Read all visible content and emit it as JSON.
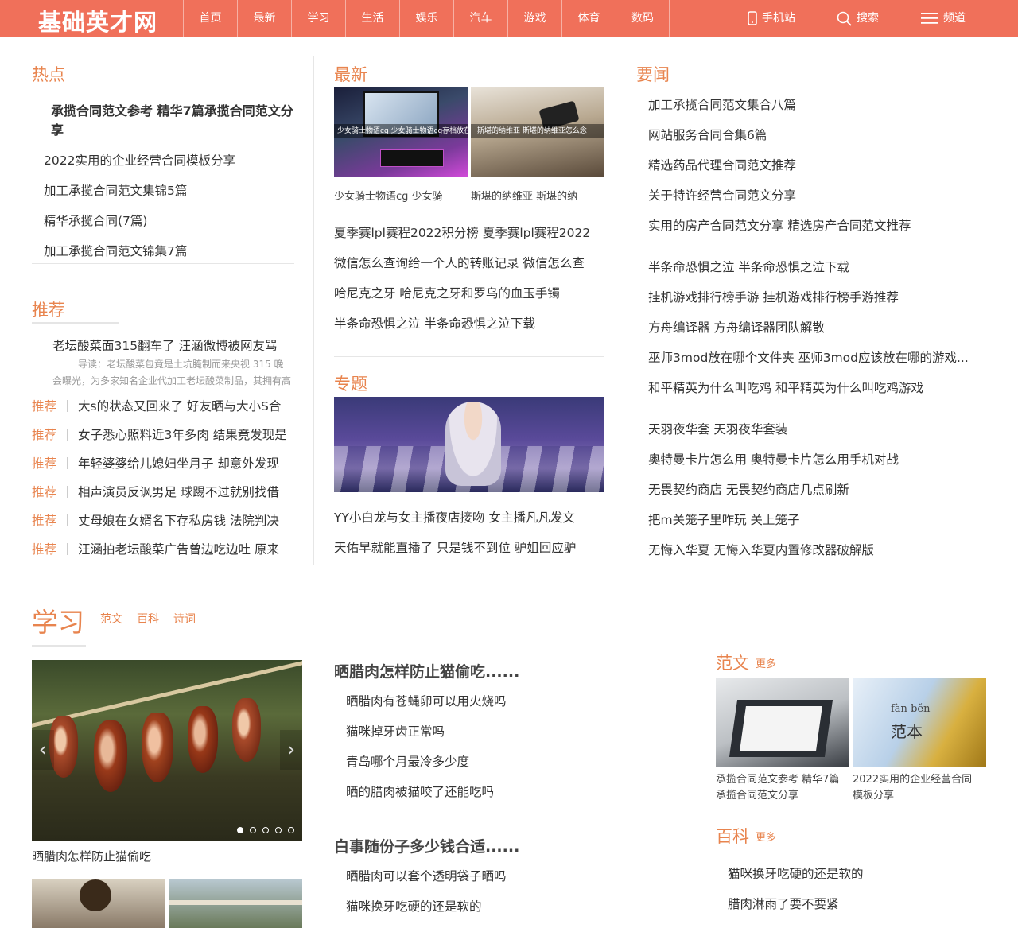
{
  "header": {
    "logo": "基础英才网",
    "nav": [
      "首页",
      "最新",
      "学习",
      "生活",
      "娱乐",
      "汽车",
      "游戏",
      "体育",
      "数码"
    ],
    "mobile": "手机站",
    "search": "搜索",
    "channel": "频道",
    "bg_color": "#f0705a"
  },
  "hot": {
    "title": "热点",
    "lead": "承揽合同范文参考 精华7篇承揽合同范文分享",
    "items": [
      "2022实用的企业经营合同模板分享",
      "加工承揽合同范文集锦5篇",
      "精华承揽合同(7篇)",
      "加工承揽合同范文锦集7篇"
    ]
  },
  "recommend": {
    "title": "推荐",
    "lead": "老坛酸菜面315翻车了 汪涵微博被网友骂",
    "lead_desc": "导读：老坛酸菜包竟是土坑腌制而来央视 315 晚会曝光，为多家知名企业代加工老坛酸菜制品，其拥有高标",
    "tag": "推荐",
    "items": [
      "大s的状态又回来了 好友晒与大小S合",
      "女子悉心照料近3年多肉 结果竟发现是",
      "年轻婆婆给儿媳妇坐月子 却意外发现",
      "相声演员反讽男足 球踢不过就别找借",
      "丈母娘在女婿名下存私房钱 法院判决",
      "汪涵拍老坛酸菜广告曾边吃边吐 原来"
    ]
  },
  "latest": {
    "title": "最新",
    "pics": [
      {
        "overlay": "少女骑士物语cg 少女骑士物语cg存档放在哪里",
        "caption": "少女骑士物语cg 少女骑"
      },
      {
        "overlay": "斯堪的纳维亚 斯堪的纳维亚怎么念",
        "caption": "斯堪的纳维亚 斯堪的纳"
      }
    ],
    "items": [
      "夏季赛lpl赛程2022积分榜 夏季赛lpl赛程2022",
      "微信怎么查询给一个人的转账记录 微信怎么查",
      "哈尼克之牙 哈尼克之牙和罗乌的血玉手镯",
      "半条命恐惧之泣 半条命恐惧之泣下载"
    ]
  },
  "special": {
    "title": "专题",
    "items": [
      "YY小白龙与女主播夜店接吻 女主播凡凡发文",
      "天佑早就能直播了 只是钱不到位 驴姐回应驴"
    ]
  },
  "news": {
    "title": "要闻",
    "group1": [
      "加工承揽合同范文集合八篇",
      "网站服务合同合集6篇",
      "精选药品代理合同范文推荐",
      "关于特许经营合同范文分享",
      "实用的房产合同范文分享 精选房产合同范文推荐"
    ],
    "group2": [
      "半条命恐惧之泣 半条命恐惧之泣下载",
      "挂机游戏排行榜手游 挂机游戏排行榜手游推荐",
      "方舟编译器 方舟编译器团队解散",
      "巫师3mod放在哪个文件夹 巫师3mod应该放在哪的游戏...",
      "和平精英为什么叫吃鸡 和平精英为什么叫吃鸡游戏"
    ],
    "group3": [
      "天羽夜华套 天羽夜华套装",
      "奥特曼卡片怎么用 奥特曼卡片怎么用手机对战",
      "无畏契约商店 无畏契约商店几点刷新",
      "把m关笼子里咋玩 关上笼子",
      "无悔入华夏 无悔入华夏内置修改器破解版"
    ]
  },
  "study": {
    "title": "学习",
    "tabs": [
      "范文",
      "百科",
      "诗词"
    ],
    "slider_caption": "晒腊肉怎样防止猫偷吃",
    "slider_dots": 5,
    "blocks": [
      {
        "heading": "晒腊肉怎样防止猫偷吃......",
        "items": [
          "晒腊肉有苍蝇卵可以用火烧吗",
          "猫咪掉牙齿正常吗",
          "青岛哪个月最冷多少度",
          "晒的腊肉被猫咬了还能吃吗"
        ]
      },
      {
        "heading": "白事随份子多少钱合适......",
        "items": [
          "晒腊肉可以套个透明袋子晒吗",
          "猫咪换牙吃硬的还是软的"
        ]
      }
    ]
  },
  "fanwen": {
    "title": "范文",
    "more": "更多",
    "book_pinyin": "fàn běn",
    "book_char": "范本",
    "thumbs": [
      "承揽合同范文参考 精华7篇承揽合同范文分享",
      "2022实用的企业经营合同模板分享"
    ]
  },
  "baike": {
    "title": "百科",
    "more": "更多",
    "items": [
      "猫咪换牙吃硬的还是软的",
      "腊肉淋雨了要不要紧"
    ]
  }
}
